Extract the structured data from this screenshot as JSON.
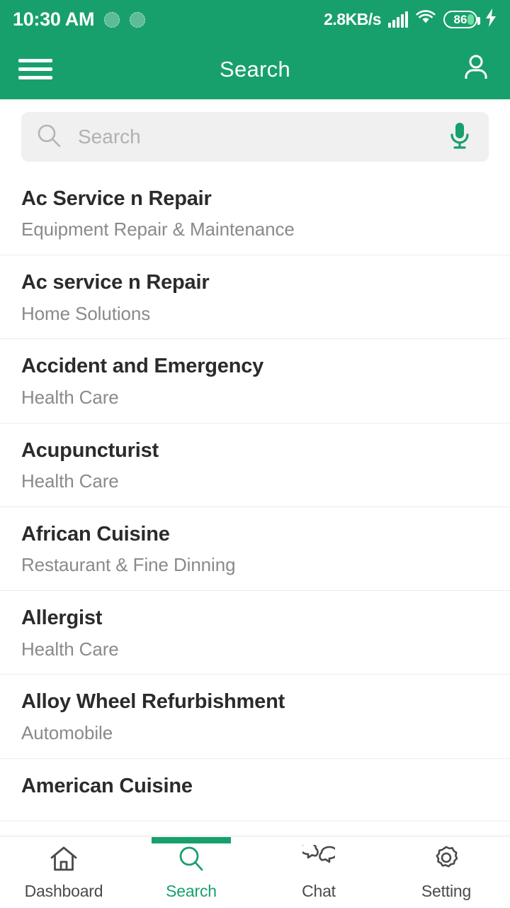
{
  "status_bar": {
    "time": "10:30 AM",
    "network_speed": "2.8KB/s",
    "battery_level": "86",
    "icons": [
      "notification-dot-icon",
      "notification-dot-icon",
      "signal-bars-icon",
      "wifi-icon",
      "battery-icon",
      "charging-bolt-icon"
    ]
  },
  "app_bar": {
    "title": "Search",
    "menu_icon": "hamburger-menu-icon",
    "profile_icon": "person-icon"
  },
  "search": {
    "value": "",
    "placeholder": "Search",
    "search_icon": "magnifier-icon",
    "mic_icon": "microphone-icon"
  },
  "results": [
    {
      "title": "Ac Service n Repair",
      "category": "Equipment Repair & Maintenance"
    },
    {
      "title": "Ac service n Repair",
      "category": "Home Solutions"
    },
    {
      "title": "Accident and Emergency",
      "category": "Health Care"
    },
    {
      "title": "Acupuncturist",
      "category": "Health Care"
    },
    {
      "title": "African Cuisine",
      "category": "Restaurant & Fine Dinning"
    },
    {
      "title": "Allergist",
      "category": "Health Care"
    },
    {
      "title": "Alloy Wheel Refurbishment",
      "category": "Automobile"
    },
    {
      "title": "American Cuisine",
      "category": ""
    }
  ],
  "bottom_nav": {
    "active": "Search",
    "items": [
      {
        "label": "Dashboard",
        "icon": "home-icon"
      },
      {
        "label": "Search",
        "icon": "magnifier-icon"
      },
      {
        "label": "Chat",
        "icon": "chat-bubbles-icon"
      },
      {
        "label": "Setting",
        "icon": "gear-icon"
      }
    ]
  },
  "colors": {
    "brand_green": "#18A06C",
    "search_field_bg": "#f0f0f0",
    "title_text": "#2b2b2b",
    "subtitle_text": "#8a8a8a",
    "divider": "#ededed"
  }
}
